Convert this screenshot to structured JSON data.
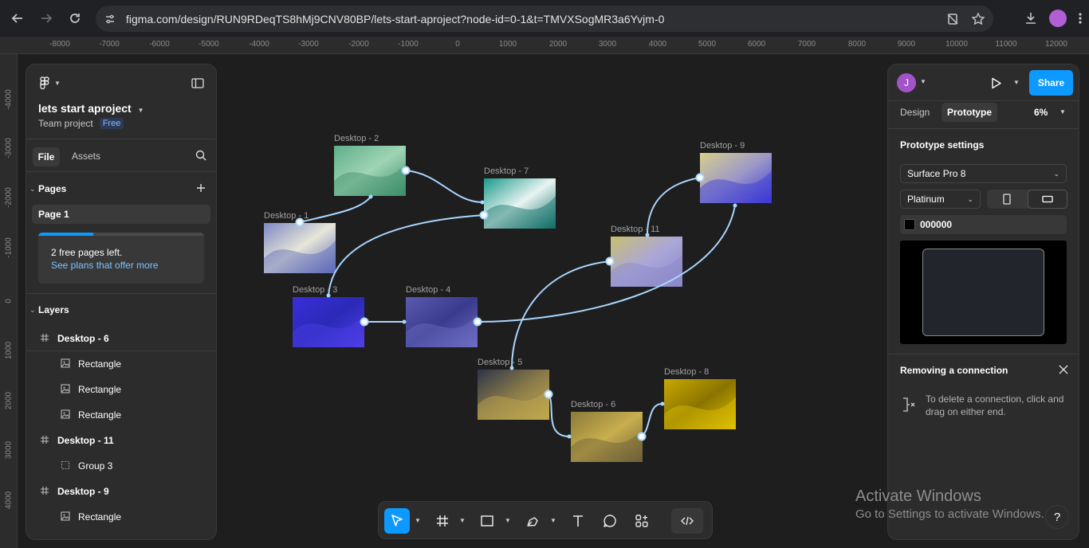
{
  "browser": {
    "url": "figma.com/design/RUN9RDeqTS8hMj9CNV80BP/lets-start-aproject?node-id=0-1&t=TMVXSogMR3a6Yvjm-0"
  },
  "rulers": {
    "top": [
      "-8000",
      "-7000",
      "-6000",
      "-5000",
      "-4000",
      "-3000",
      "-2000",
      "-1000",
      "0",
      "1000",
      "2000",
      "3000",
      "4000",
      "5000",
      "6000",
      "7000",
      "8000",
      "9000",
      "10000",
      "11000",
      "12000"
    ],
    "left": [
      "-4000",
      "-3000",
      "-2000",
      "-1000",
      "0",
      "1000",
      "2000",
      "3000",
      "4000"
    ]
  },
  "left_panel": {
    "file_name": "lets start aproject",
    "team": "Team project",
    "plan_badge": "Free",
    "tabs": {
      "file": "File",
      "assets": "Assets"
    },
    "pages_title": "Pages",
    "page_1": "Page 1",
    "plan_card": {
      "text": "2 free pages left.",
      "link": "See plans that offer more",
      "progress": 0.33
    },
    "layers_title": "Layers",
    "layers": [
      {
        "label": "Desktop - 6",
        "icon": "frame-icon",
        "bold": true,
        "indent": 0
      },
      {
        "label": "Rectangle",
        "icon": "image-icon",
        "bold": false,
        "indent": 1
      },
      {
        "label": "Rectangle",
        "icon": "image-icon",
        "bold": false,
        "indent": 1
      },
      {
        "label": "Rectangle",
        "icon": "image-icon",
        "bold": false,
        "indent": 1
      },
      {
        "label": "Desktop - 11",
        "icon": "frame-icon",
        "bold": true,
        "indent": 0
      },
      {
        "label": "Group 3",
        "icon": "group-icon",
        "bold": false,
        "indent": 1
      },
      {
        "label": "Desktop - 9",
        "icon": "frame-icon",
        "bold": true,
        "indent": 0
      },
      {
        "label": "Rectangle",
        "icon": "image-icon",
        "bold": false,
        "indent": 1
      }
    ]
  },
  "frames": [
    {
      "id": "desktop-2",
      "title": "Desktop - 2",
      "colors": [
        "#5fae8a",
        "#9fd4b4",
        "#3d8f6a"
      ]
    },
    {
      "id": "desktop-7",
      "title": "Desktop - 7",
      "colors": [
        "#1a9a8a",
        "#e8f4f2",
        "#0d6e66"
      ]
    },
    {
      "id": "desktop-1",
      "title": "Desktop - 1",
      "colors": [
        "#7e88c4",
        "#e6e6d8",
        "#5a68b8"
      ]
    },
    {
      "id": "desktop-3",
      "title": "Desktop - 3",
      "colors": [
        "#3a2ed8",
        "#2a2ab8",
        "#4e3ee6"
      ]
    },
    {
      "id": "desktop-4",
      "title": "Desktop - 4",
      "colors": [
        "#5a5ab0",
        "#3a3a8e",
        "#6c6cc4"
      ]
    },
    {
      "id": "desktop-9",
      "title": "Desktop - 9",
      "colors": [
        "#d8cf8a",
        "#9c98c8",
        "#3a38d4"
      ]
    },
    {
      "id": "desktop-11",
      "title": "Desktop - 11",
      "colors": [
        "#c8c070",
        "#aaa6d8",
        "#8c88c8"
      ]
    },
    {
      "id": "desktop-5",
      "title": "Desktop - 5",
      "colors": [
        "#2c3448",
        "#8a7a4a",
        "#c0a84e"
      ]
    },
    {
      "id": "desktop-6",
      "title": "Desktop - 6",
      "colors": [
        "#8a7a3a",
        "#c8ae4e",
        "#6c6038"
      ]
    },
    {
      "id": "desktop-8",
      "title": "Desktop - 8",
      "colors": [
        "#c8a800",
        "#8a7400",
        "#e0c000"
      ]
    }
  ],
  "right_panel": {
    "user_initial": "J",
    "share": "Share",
    "tabs": {
      "design": "Design",
      "prototype": "Prototype"
    },
    "zoom": "6%",
    "prototype_settings_title": "Prototype settings",
    "device": "Surface Pro 8",
    "model": "Platinum",
    "background_color": "000000",
    "removing_title": "Removing a connection",
    "removing_text": "To delete a connection, click and drag on either end."
  },
  "watermark": {
    "title": "Activate Windows",
    "subtitle": "Go to Settings to activate Windows."
  },
  "help": "?",
  "colors": {
    "accent": "#0d99ff",
    "connector": "#a9d6ff",
    "avatar": "#a353c8"
  }
}
